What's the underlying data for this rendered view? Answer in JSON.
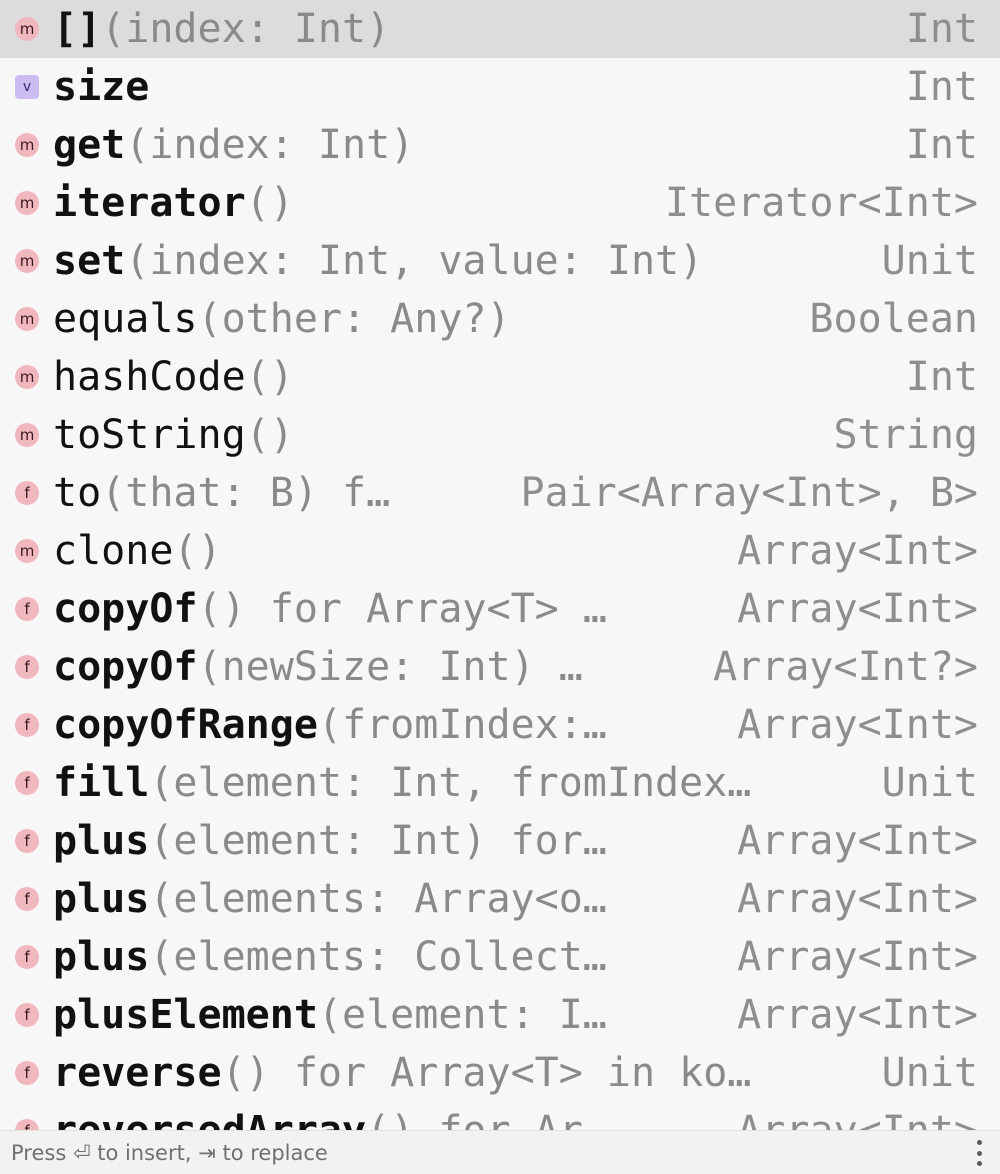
{
  "completion": {
    "items": [
      {
        "kind": "m",
        "name": "[]",
        "bold": true,
        "sig": "(index: Int)",
        "type": "Int",
        "selected": true
      },
      {
        "kind": "v",
        "name": "size",
        "bold": true,
        "sig": "",
        "type": "Int"
      },
      {
        "kind": "m",
        "name": "get",
        "bold": true,
        "sig": "(index: Int)",
        "type": "Int"
      },
      {
        "kind": "m",
        "name": "iterator",
        "bold": true,
        "sig": "()",
        "type": "Iterator<Int>"
      },
      {
        "kind": "m",
        "name": "set",
        "bold": true,
        "sig": "(index: Int, value: Int)",
        "type": "Unit"
      },
      {
        "kind": "m",
        "name": "equals",
        "bold": false,
        "sig": "(other: Any?)",
        "type": "Boolean"
      },
      {
        "kind": "m",
        "name": "hashCode",
        "bold": false,
        "sig": "()",
        "type": "Int"
      },
      {
        "kind": "m",
        "name": "toString",
        "bold": false,
        "sig": "()",
        "type": "String"
      },
      {
        "kind": "f",
        "name": "to",
        "bold": false,
        "sig": "(that: B) f…",
        "type": "Pair<Array<Int>, B>"
      },
      {
        "kind": "m",
        "name": "clone",
        "bold": false,
        "sig": "()",
        "type": "Array<Int>"
      },
      {
        "kind": "f",
        "name": "copyOf",
        "bold": true,
        "sig": "() for Array<T> …",
        "type": "Array<Int>"
      },
      {
        "kind": "f",
        "name": "copyOf",
        "bold": true,
        "sig": "(newSize: Int) …",
        "type": "Array<Int?>"
      },
      {
        "kind": "f",
        "name": "copyOfRange",
        "bold": true,
        "sig": "(fromIndex:…",
        "type": "Array<Int>"
      },
      {
        "kind": "f",
        "name": "fill",
        "bold": true,
        "sig": "(element: Int, fromIndex…",
        "type": "Unit"
      },
      {
        "kind": "f",
        "name": "plus",
        "bold": true,
        "sig": "(element: Int) for…",
        "type": "Array<Int>"
      },
      {
        "kind": "f",
        "name": "plus",
        "bold": true,
        "sig": "(elements: Array<o…",
        "type": "Array<Int>"
      },
      {
        "kind": "f",
        "name": "plus",
        "bold": true,
        "sig": "(elements: Collect…",
        "type": "Array<Int>"
      },
      {
        "kind": "f",
        "name": "plusElement",
        "bold": true,
        "sig": "(element: I…",
        "type": "Array<Int>"
      },
      {
        "kind": "f",
        "name": "reverse",
        "bold": true,
        "sig": "() for Array<T> in ko…",
        "type": "Unit"
      },
      {
        "kind": "f",
        "name": "reversedArray",
        "bold": true,
        "sig": "() for Ar…",
        "type": "Array<Int>"
      }
    ]
  },
  "footer": {
    "hint": "Press ⏎ to insert, ⇥ to replace",
    "more_icon": "vertical-ellipsis-icon"
  }
}
